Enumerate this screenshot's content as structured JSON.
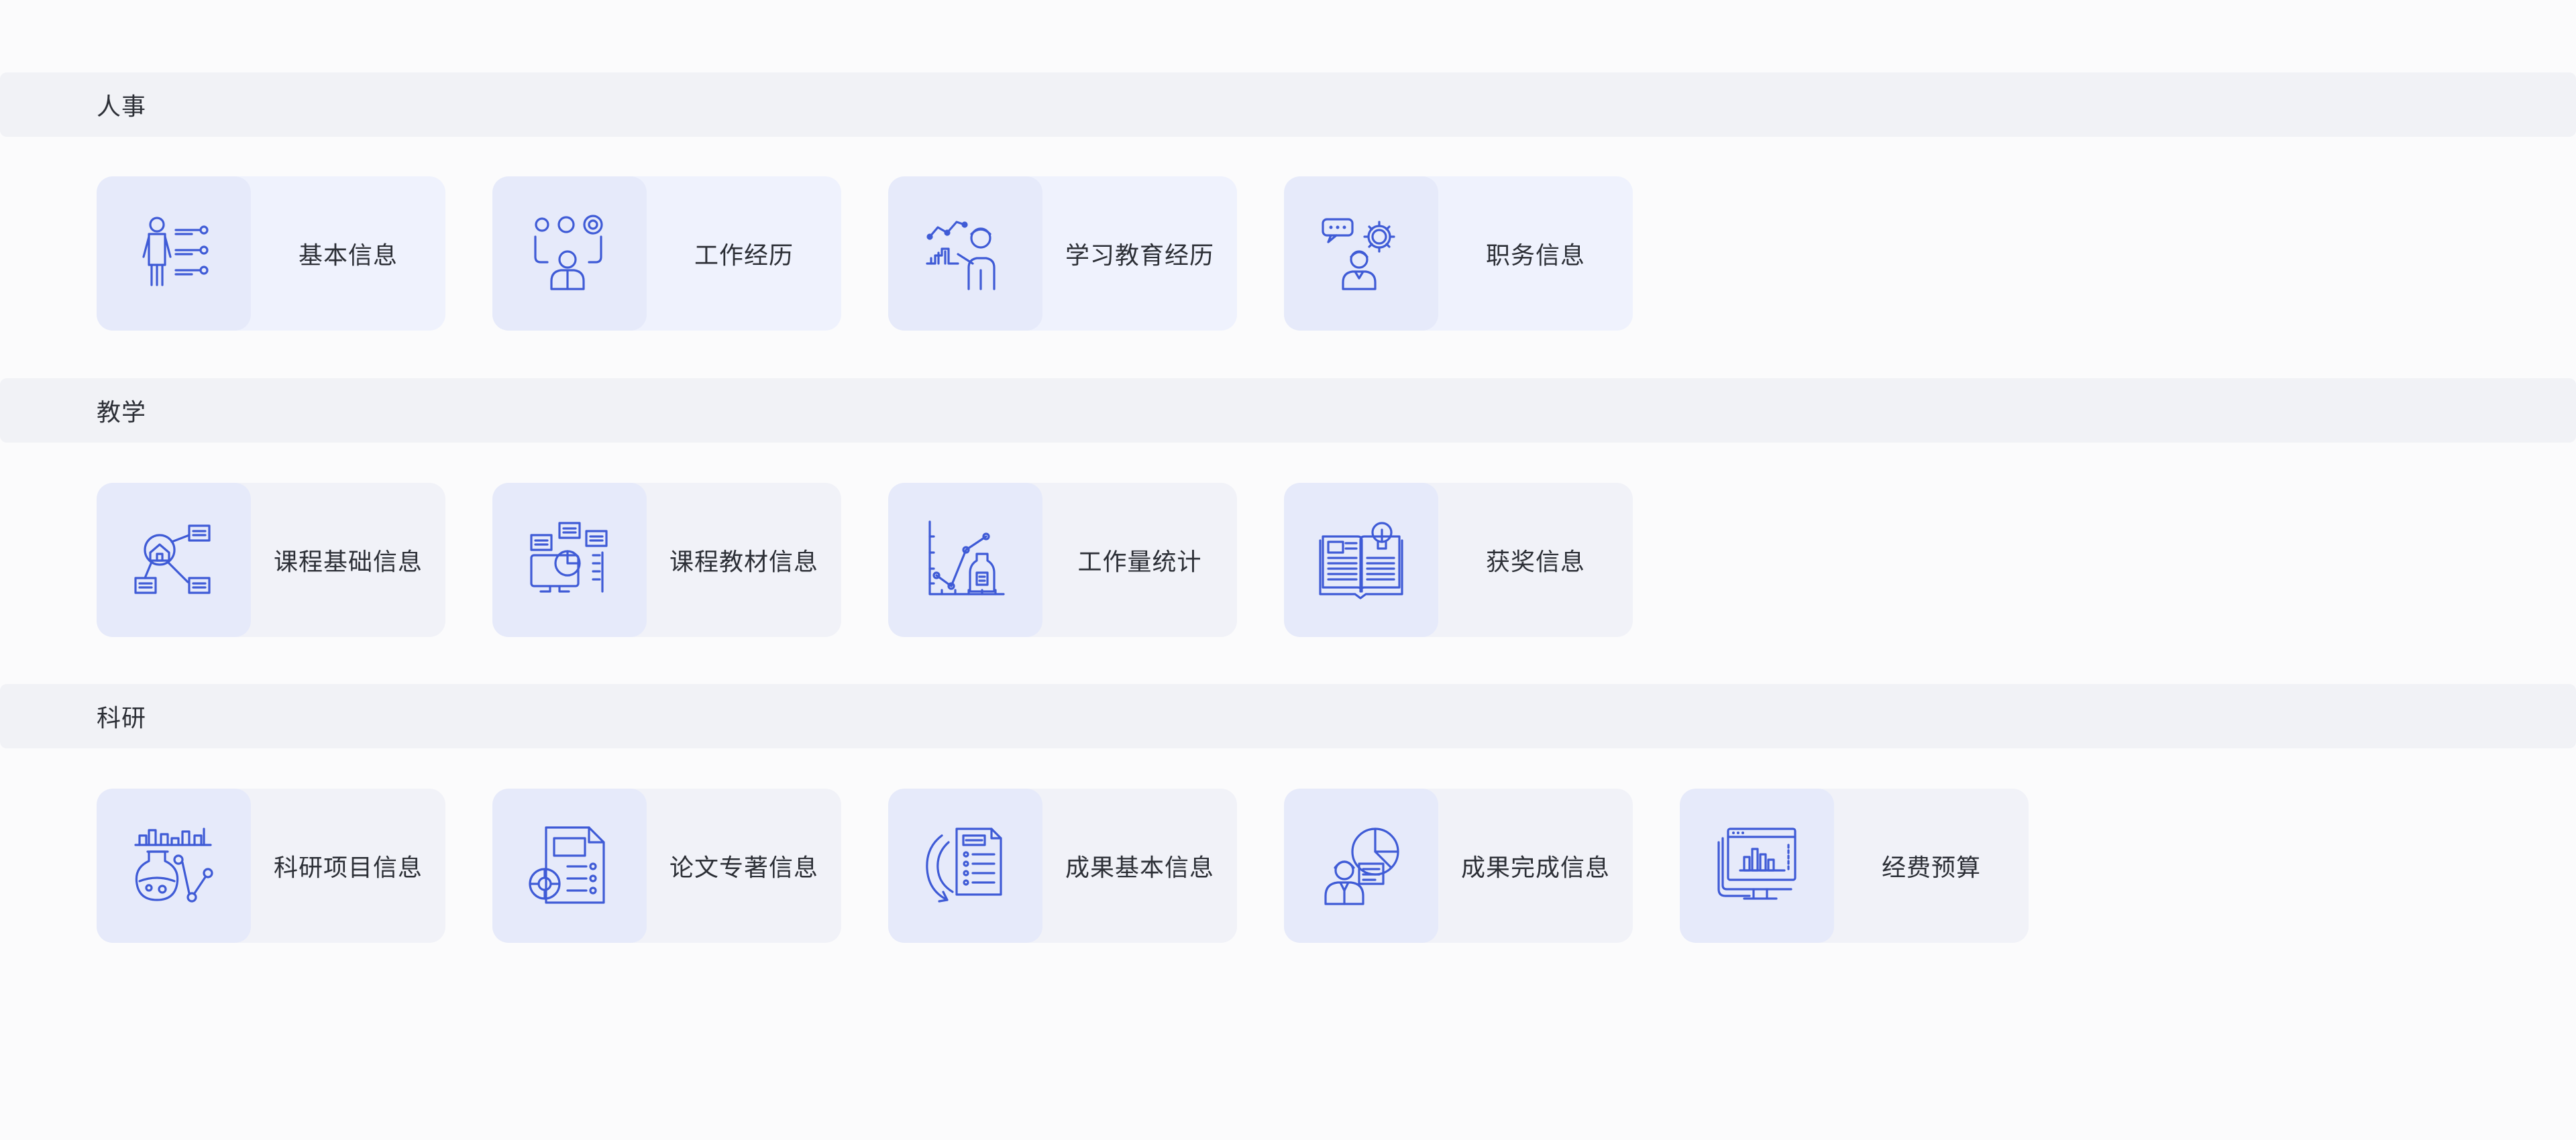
{
  "sections": [
    {
      "title": "人事",
      "cards": [
        {
          "label": "基本信息",
          "icon": "person-list-icon"
        },
        {
          "label": "工作经历",
          "icon": "person-options-icon"
        },
        {
          "label": "学习教育经历",
          "icon": "person-growth-chart-icon"
        },
        {
          "label": "职务信息",
          "icon": "person-settings-icon"
        }
      ]
    },
    {
      "title": "教学",
      "cards": [
        {
          "label": "课程基础信息",
          "icon": "course-network-icon"
        },
        {
          "label": "课程教材信息",
          "icon": "computer-pie-chart-icon"
        },
        {
          "label": "工作量统计",
          "icon": "line-chart-bottle-icon"
        },
        {
          "label": "获奖信息",
          "icon": "open-book-bulb-icon"
        }
      ]
    },
    {
      "title": "科研",
      "cards": [
        {
          "label": "科研项目信息",
          "icon": "lab-flask-icon"
        },
        {
          "label": "论文专著信息",
          "icon": "document-chart-icon"
        },
        {
          "label": "成果基本信息",
          "icon": "document-refresh-icon"
        },
        {
          "label": "成果完成信息",
          "icon": "person-pie-chart-icon"
        },
        {
          "label": "经费预算",
          "icon": "monitor-bar-chart-icon"
        }
      ]
    }
  ],
  "colors": {
    "accent": "#3f5bd6",
    "section_bar": "#f1f2f6",
    "card_bg_hr": "#eff2fd",
    "card_bg": "#f1f2f8",
    "icon_box": "#e6eafa",
    "background": "#fbfbfc"
  }
}
